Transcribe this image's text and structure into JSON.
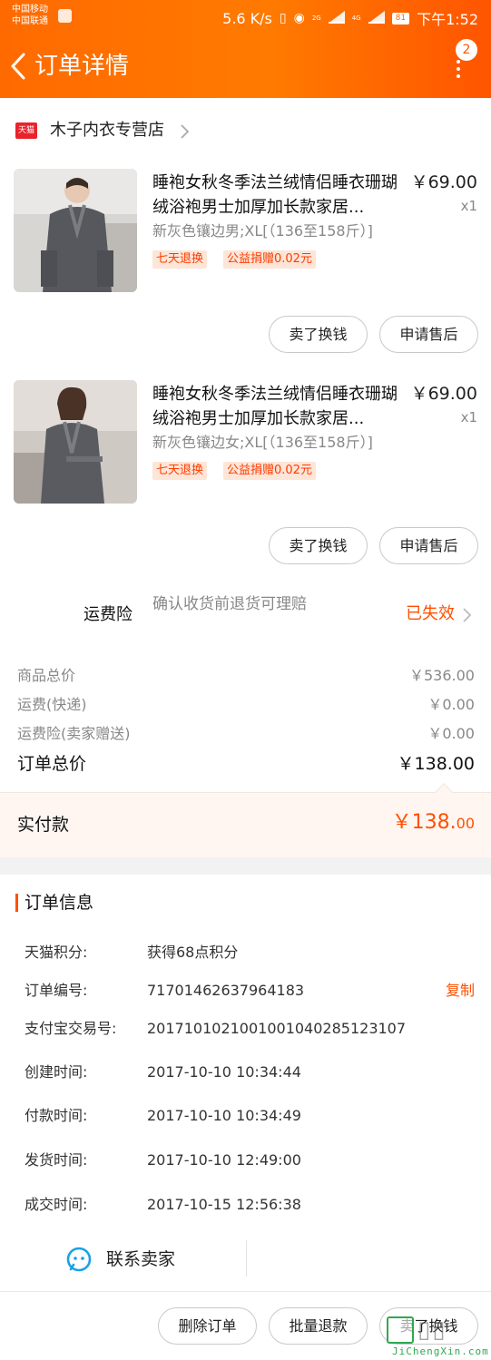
{
  "status_bar": {
    "carrier1": "中国移动",
    "carrier2": "中国联通",
    "speed": "5.6 K/s",
    "net1": "2G",
    "net2": "4G",
    "battery": "81",
    "time": "下午1:52"
  },
  "header": {
    "title": "订单详情",
    "notification_count": "2",
    "accent_color": "#ff6a00"
  },
  "store": {
    "badge": "天猫",
    "name": "木子内衣专营店"
  },
  "products": [
    {
      "title": "睡袍女秋冬季法兰绒情侣睡衣珊瑚绒浴袍男士加厚加长款家居...",
      "price": "￥69.00",
      "qty": "x1",
      "sku": "新灰色镶边男;XL[（136至158斤）]",
      "tag1": "七天退换",
      "tag2": "公益捐赠0.02元",
      "btn1": "卖了换钱",
      "btn2": "申请售后"
    },
    {
      "title": "睡袍女秋冬季法兰绒情侣睡衣珊瑚绒浴袍男士加厚加长款家居...",
      "price": "￥69.00",
      "qty": "x1",
      "sku": "新灰色镶边女;XL[（136至158斤）]",
      "tag1": "七天退换",
      "tag2": "公益捐赠0.02元",
      "btn1": "卖了换钱",
      "btn2": "申请售后"
    }
  ],
  "insurance": {
    "label": "运费险",
    "desc": "确认收货前退货可理赔",
    "status": "已失效"
  },
  "summary": {
    "goods_label": "商品总价",
    "goods_value": "￥536.00",
    "shipping_label": "运费(快递)",
    "shipping_value": "￥0.00",
    "ins_label": "运费险(卖家赠送)",
    "ins_value": "￥0.00",
    "total_label": "订单总价",
    "total_value": "￥138.00",
    "paid_label": "实付款",
    "paid_int": "￥138.",
    "paid_dec": "00"
  },
  "order_info": {
    "title": "订单信息",
    "rows": [
      {
        "key": "天猫积分:",
        "value": "获得68点积分"
      },
      {
        "key": "订单编号:",
        "value": "71701462637964183"
      },
      {
        "key": "支付宝交易号:",
        "value": "2017101021001001040285123107"
      },
      {
        "key": "创建时间:",
        "value": "2017-10-10 10:34:44"
      },
      {
        "key": "付款时间:",
        "value": "2017-10-10 10:34:49"
      },
      {
        "key": "发货时间:",
        "value": "2017-10-10 12:49:00"
      },
      {
        "key": "成交时间:",
        "value": "2017-10-15 12:56:38"
      }
    ],
    "copy_label": "复制"
  },
  "contact": {
    "label": "联系卖家"
  },
  "bottom_actions": {
    "delete": "删除订单",
    "batch_refund": "批量退款",
    "sell": "卖了换钱"
  },
  "watermark": {
    "text": "JiChengXin.com"
  }
}
